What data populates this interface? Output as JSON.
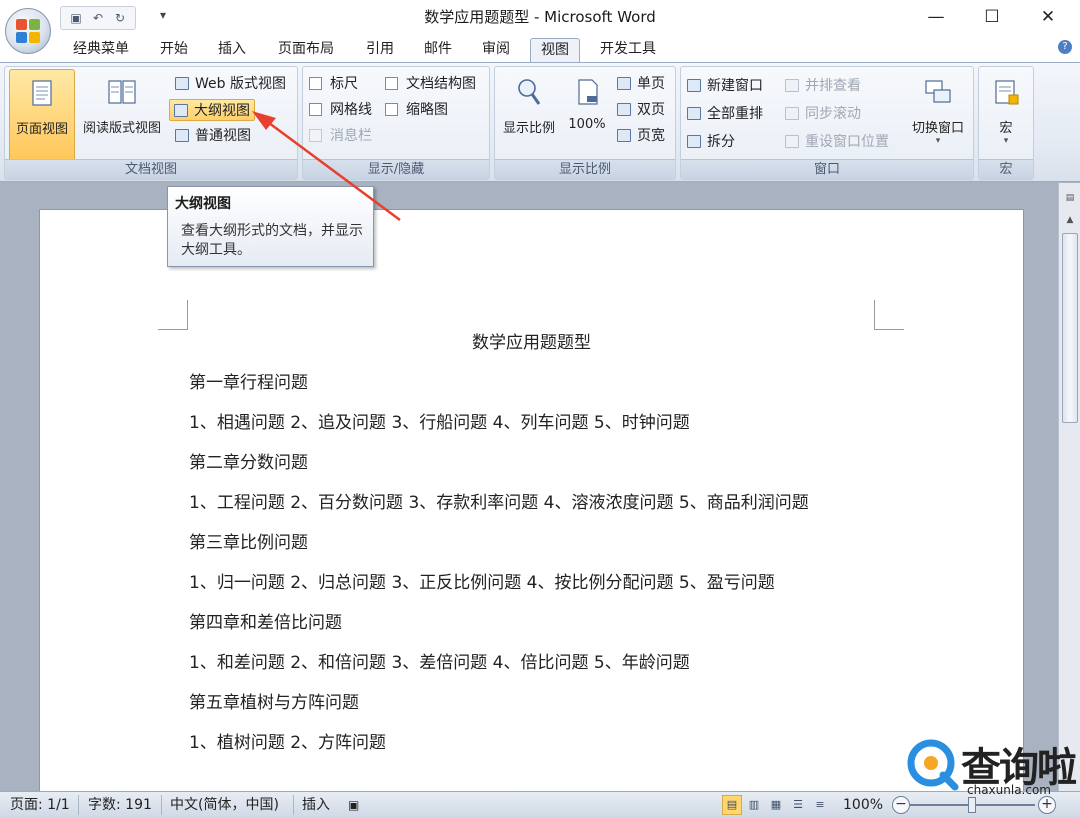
{
  "window": {
    "title": "数学应用题题型 - Microsoft Word"
  },
  "tabs": [
    "经典菜单",
    "开始",
    "插入",
    "页面布局",
    "引用",
    "邮件",
    "审阅",
    "视图",
    "开发工具"
  ],
  "active_tab": "视图",
  "ribbon": {
    "doc_views": {
      "label": "文档视图",
      "page_view": "页面视图",
      "reading_view": "阅读版式视图",
      "web_view": "Web 版式视图",
      "outline_view": "大纲视图",
      "normal_view": "普通视图"
    },
    "show_hide": {
      "label": "显示/隐藏",
      "ruler": "标尺",
      "doc_map": "文档结构图",
      "gridlines": "网格线",
      "thumbnails": "缩略图",
      "message_bar": "消息栏"
    },
    "zoom": {
      "label": "显示比例",
      "zoom": "显示比例",
      "hundred": "100%",
      "one_page": "单页",
      "two_pages": "双页",
      "page_width": "页宽"
    },
    "window": {
      "label": "窗口",
      "new_window": "新建窗口",
      "arrange_all": "全部重排",
      "split": "拆分",
      "side_by_side": "并排查看",
      "sync_scroll": "同步滚动",
      "reset_position": "重设窗口位置",
      "switch_windows": "切换窗口"
    },
    "macros": {
      "label": "宏",
      "macros": "宏"
    }
  },
  "tooltip": {
    "title": "大纲视图",
    "body": "查看大纲形式的文档，并显示大纲工具。"
  },
  "document": {
    "title": "数学应用题题型",
    "lines": [
      "第一章行程问题",
      "1、相遇问题  2、追及问题  3、行船问题  4、列车问题  5、时钟问题",
      "第二章分数问题",
      "1、工程问题  2、百分数问题  3、存款利率问题  4、溶液浓度问题  5、商品利润问题",
      "第三章比例问题",
      "1、归一问题  2、归总问题  3、正反比例问题  4、按比例分配问题  5、盈亏问题",
      "第四章和差倍比问题",
      "1、和差问题  2、和倍问题  3、差倍问题  4、倍比问题  5、年龄问题",
      "第五章植树与方阵问题",
      "1、植树问题  2、方阵问题"
    ]
  },
  "status": {
    "page": "页面: 1/1",
    "words": "字数: 191",
    "language": "中文(简体，中国)",
    "mode": "插入",
    "zoom": "100%"
  },
  "watermark": {
    "text": "查询啦",
    "url": "chaxunla.com"
  },
  "colors": {
    "accent_active": "#ffc75a",
    "annotation_arrow": "#e8402e",
    "ribbon_bg": "#e4eaf3"
  }
}
